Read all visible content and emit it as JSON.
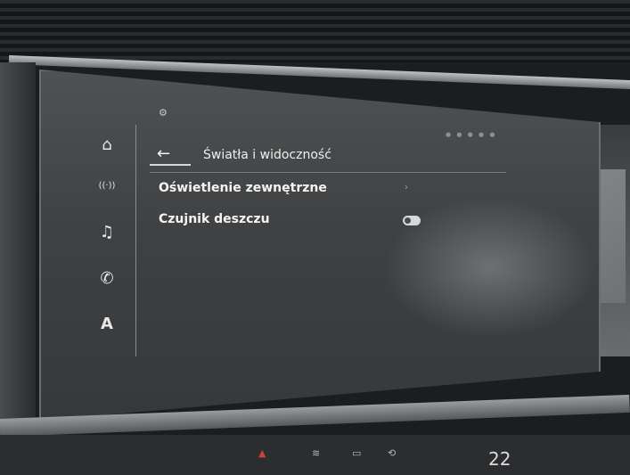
{
  "header": {
    "breadcrumb_parent": "",
    "title": "Światła i widoczność",
    "back_icon": "back-arrow-icon"
  },
  "nav_rail": [
    {
      "icon": "home-icon",
      "glyph": "⌂"
    },
    {
      "icon": "radio-icon",
      "glyph": "((·))"
    },
    {
      "icon": "music-icon",
      "glyph": "♫"
    },
    {
      "icon": "phone-icon",
      "glyph": "✆"
    },
    {
      "icon": "navigation-icon",
      "glyph": "A"
    }
  ],
  "settings_list": [
    {
      "label": "Oświetlenie zewnętrzne",
      "control": "chevron",
      "chevron": "›"
    },
    {
      "label": "Czujnik deszczu",
      "control": "toggle",
      "state": "on"
    }
  ],
  "bottom_bar": {
    "temperature": "22"
  },
  "colors": {
    "accent": "#c8413a",
    "screen_bg": "#3f4143",
    "text": "#f4f4f4"
  }
}
